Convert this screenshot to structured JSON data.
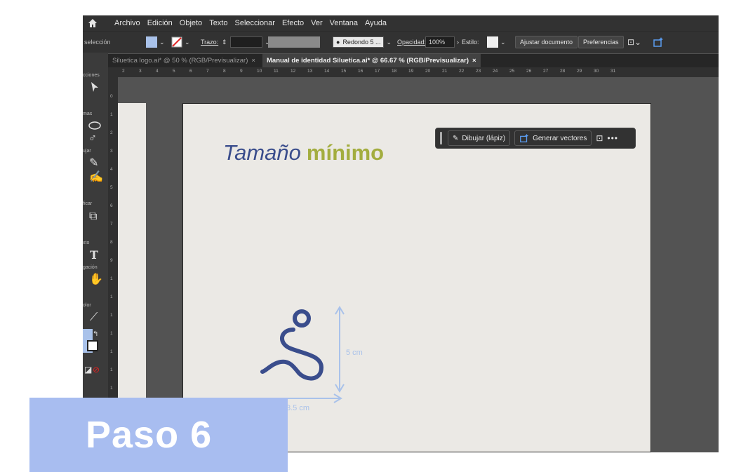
{
  "menubar": {
    "items": [
      "Archivo",
      "Edición",
      "Objeto",
      "Texto",
      "Seleccionar",
      "Efecto",
      "Ver",
      "Ventana",
      "Ayuda"
    ]
  },
  "controlbar": {
    "selection_label": "selección",
    "stroke_label": "Trazo:",
    "brush_value": "Redondo 5 ...",
    "opacity_label": "Opacidad:",
    "opacity_value": "100%",
    "style_label": "Estilo:",
    "fit_button": "Ajustar documento",
    "prefs_button": "Preferencias"
  },
  "tabs": [
    {
      "label": "Siluetica logo.ai* @ 50 % (RGB/Previsualizar)",
      "close": "×"
    },
    {
      "label": "Manual de identidad Siluetica.ai* @ 66.67 % (RGB/Previsualizar)",
      "close": "×"
    }
  ],
  "toolbar_labels": [
    "cciones",
    "mas",
    "ujar",
    "ficar",
    "xto",
    "gación",
    "olor"
  ],
  "ruler_top": [
    "2",
    "3",
    "4",
    "5",
    "6",
    "7",
    "8",
    "9",
    "10",
    "11",
    "12",
    "13",
    "14",
    "15",
    "16",
    "17",
    "18",
    "19",
    "20",
    "21",
    "22",
    "23",
    "24",
    "25",
    "26",
    "27",
    "28",
    "29",
    "30",
    "31"
  ],
  "ruler_left": [
    "0",
    "1",
    "2",
    "3",
    "4",
    "5",
    "6",
    "7",
    "8",
    "9",
    "1",
    "1",
    "1",
    "1",
    "1",
    "1",
    "1",
    "1",
    "1",
    "1"
  ],
  "taskbar": {
    "draw_label": "Dibujar (lápiz)",
    "vectors_label": "Generar vectores",
    "more": "•••"
  },
  "artboard": {
    "heading_word1": "Tamaño",
    "heading_word2": "mínimo",
    "dim_height": "5 cm",
    "dim_width": "3.5 cm"
  },
  "badge": {
    "text": "Paso 6"
  },
  "colors": {
    "heading_blue": "#3a4d8c",
    "heading_green": "#a3ad3f",
    "dimension_blue": "#a9c2ea",
    "badge_bg": "#a8bdf0"
  }
}
